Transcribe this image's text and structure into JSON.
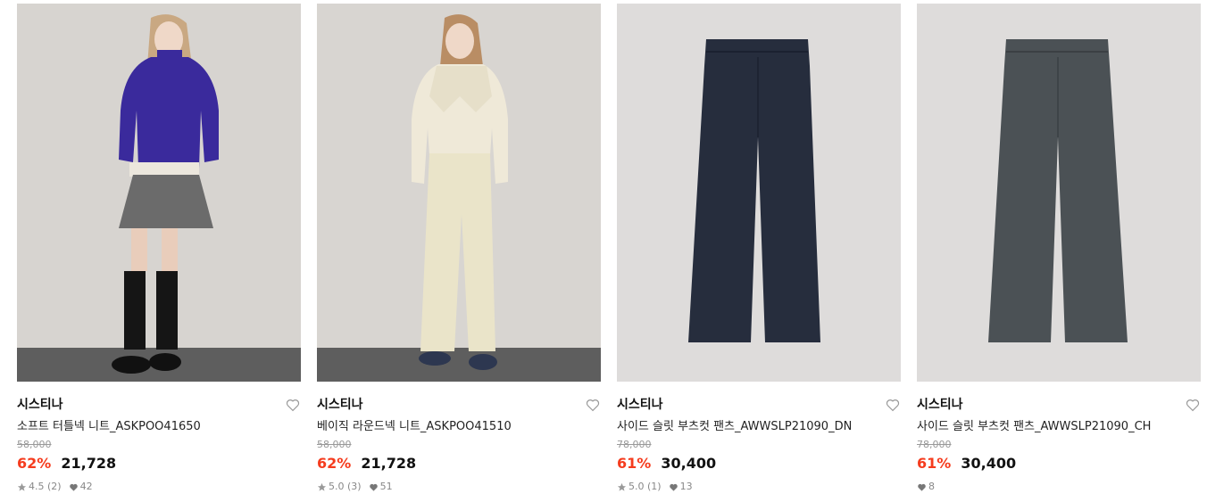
{
  "products": [
    {
      "brand": "시스티나",
      "name": "소프트 터틀넥 니트_ASKPOO41650",
      "original_price": "58,000",
      "discount": "62%",
      "price": "21,728",
      "rating": "4.5",
      "review_count": "(2)",
      "likes": "42",
      "image": "model-purple-turtleneck-knit"
    },
    {
      "brand": "시스티나",
      "name": "베이직 라운드넥 니트_ASKPOO41510",
      "original_price": "58,000",
      "discount": "62%",
      "price": "21,728",
      "rating": "5.0",
      "review_count": "(3)",
      "likes": "51",
      "image": "model-cream-roundneck-knit"
    },
    {
      "brand": "시스티나",
      "name": "사이드 슬릿 부츠컷 팬츠_AWWSLP21090_DN",
      "original_price": "78,000",
      "discount": "61%",
      "price": "30,400",
      "rating": "5.0",
      "review_count": "(1)",
      "likes": "13",
      "image": "navy-bootcut-pants"
    },
    {
      "brand": "시스티나",
      "name": "사이드 슬릿 부츠컷 팬츠_AWWSLP21090_CH",
      "original_price": "78,000",
      "discount": "61%",
      "price": "30,400",
      "rating": "",
      "review_count": "",
      "likes": "8",
      "image": "charcoal-bootcut-pants"
    }
  ],
  "colors": {
    "discount": "#f53c1e",
    "navy_pants": "#262d3d",
    "charcoal_pants": "#4b5155",
    "purple_knit": "#3a2a9c",
    "cream_knit": "#efe9d8"
  },
  "icons": {
    "wishlist": "heart-outline-icon",
    "rating": "star-icon",
    "likes": "heart-filled-icon"
  }
}
